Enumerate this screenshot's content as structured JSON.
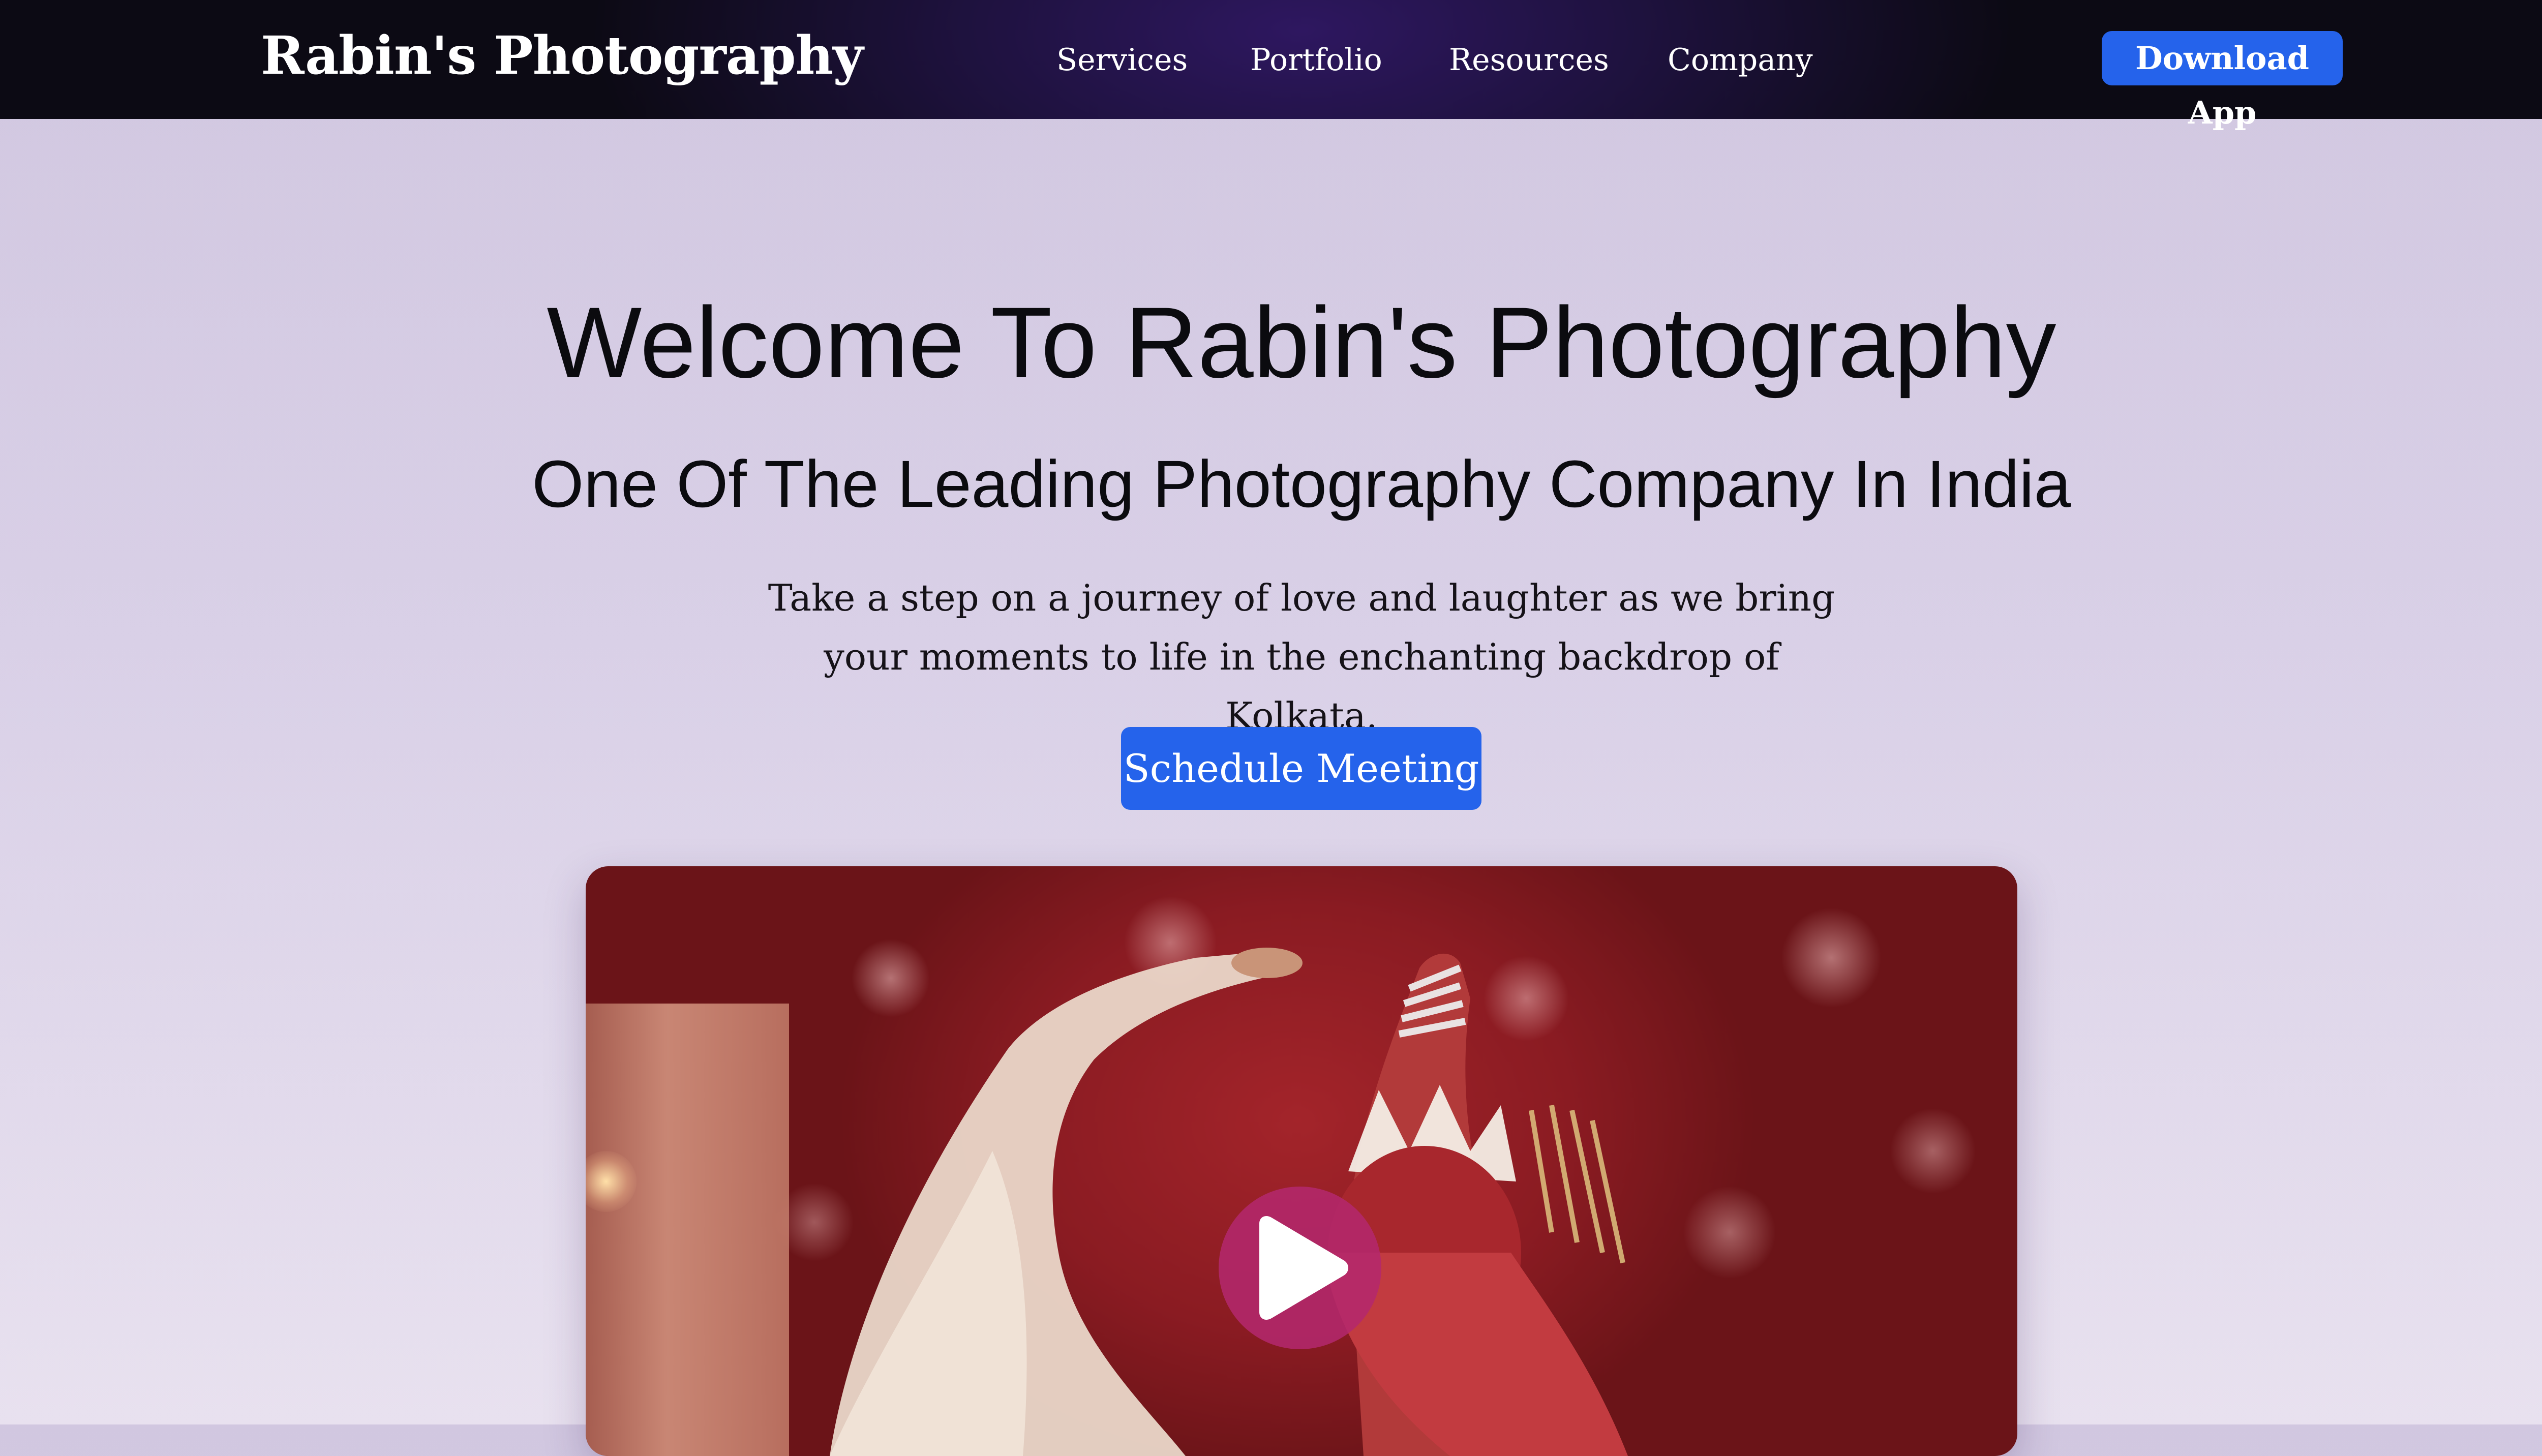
{
  "navbar": {
    "brand": "Rabin's Photography",
    "links": [
      {
        "label": "Services"
      },
      {
        "label": "Portfolio"
      },
      {
        "label": "Resources"
      },
      {
        "label": "Company"
      }
    ],
    "cta_label": "Download App"
  },
  "hero": {
    "title": "Welcome To Rabin's Photography",
    "subtitle": "One Of The Leading Photography Company In India",
    "description": "Take a step on a journey of love and laughter as we bring your moments to life in the enchanting backdrop of Kolkata.",
    "cta_label": "Schedule Meeting"
  },
  "video": {
    "play_icon": "play-icon"
  },
  "colors": {
    "accent": "#2563eb",
    "navbar_bg": "#1f1240",
    "play_button": "#b4286e",
    "page_bg": "#d9d0e7"
  }
}
